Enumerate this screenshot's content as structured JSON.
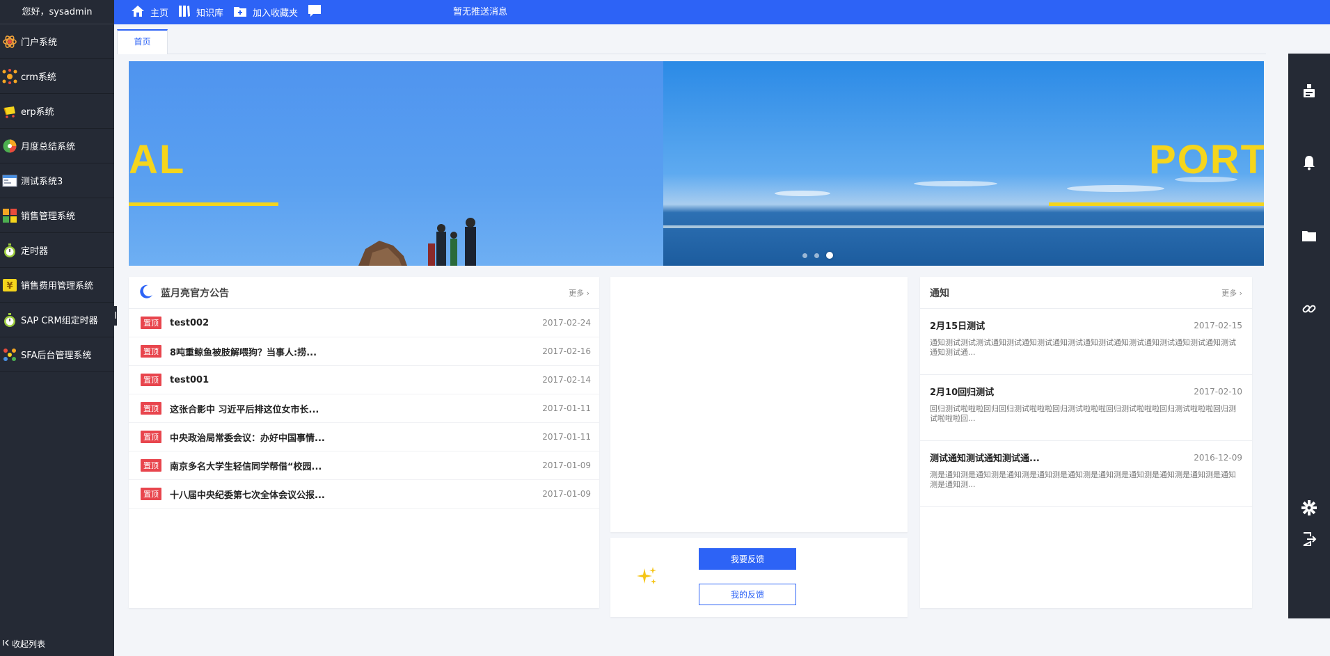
{
  "sidebar": {
    "greeting": "您好，sysadmin",
    "items": [
      {
        "label": "门户系统",
        "icon": "atom-icon"
      },
      {
        "label": "crm系统",
        "icon": "network-icon"
      },
      {
        "label": "erp系统",
        "icon": "cart-icon"
      },
      {
        "label": "月度总结系统",
        "icon": "pie-icon"
      },
      {
        "label": "测试系统3",
        "icon": "window-icon"
      },
      {
        "label": "销售管理系统",
        "icon": "blocks-icon"
      },
      {
        "label": "定时器",
        "icon": "stopwatch-icon"
      },
      {
        "label": "销售费用管理系统",
        "icon": "yen-icon"
      },
      {
        "label": "SAP CRM组定时器",
        "icon": "stopwatch-icon"
      },
      {
        "label": "SFA后台管理系统",
        "icon": "dots-icon"
      }
    ],
    "collapse_label": "收起列表"
  },
  "topbar": {
    "home": "主页",
    "knowledge": "知识库",
    "favorite": "加入收藏夹",
    "message": "暂无推送消息"
  },
  "tabs": [
    {
      "label": "首页"
    }
  ],
  "banner": {
    "left_word": "AL",
    "right_word": "PORT",
    "dots": 3,
    "active_dot": 3
  },
  "announce": {
    "title": "蓝月亮官方公告",
    "more": "更多",
    "badge": "置顶",
    "rows": [
      {
        "title": "test002",
        "date": "2017-02-24"
      },
      {
        "title": "8吨重鲸鱼被肢解喂狗？当事人:捞...",
        "date": "2017-02-16"
      },
      {
        "title": "test001",
        "date": "2017-02-14"
      },
      {
        "title": "这张合影中 习近平后排这位女市长...",
        "date": "2017-01-11"
      },
      {
        "title": "中央政治局常委会议：办好中国事情...",
        "date": "2017-01-11"
      },
      {
        "title": "南京多名大学生轻信同学帮借“校园...",
        "date": "2017-01-09"
      },
      {
        "title": "十八届中央纪委第七次全体会议公报...",
        "date": "2017-01-09"
      }
    ]
  },
  "feedback": {
    "submit": "我要反馈",
    "mine": "我的反馈"
  },
  "notice": {
    "title": "通知",
    "more": "更多",
    "items": [
      {
        "title": "2月15日测试",
        "date": "2017-02-15",
        "body": "通知测试测试测试通知测试通知测试通知测试通知测试通知测试通知测试通知测试通知测试通知测试通..."
      },
      {
        "title": "2月10回归测试",
        "date": "2017-02-10",
        "body": "回归测试啦啦啦回归回归测试啦啦啦回归测试啦啦啦回归测试啦啦啦回归测试啦啦啦回归测试啦啦啦回..."
      },
      {
        "title": "测试通知测试通知测试通...",
        "date": "2016-12-09",
        "body": "测是通知测是通知测是通知测是通知测是通知测是通知测是通知测是通知测是通知测是通知测是通知测..."
      }
    ]
  },
  "colors": {
    "primary": "#2d63f6",
    "sidebar": "#252a35",
    "badge": "#e8454d",
    "banner_accent": "#f5d51c"
  }
}
